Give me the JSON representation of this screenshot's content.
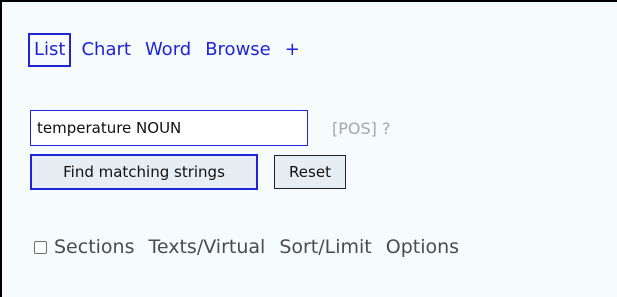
{
  "nav": {
    "items": [
      {
        "label": "List",
        "active": true
      },
      {
        "label": "Chart"
      },
      {
        "label": "Word"
      },
      {
        "label": "Browse"
      },
      {
        "label": "+"
      }
    ]
  },
  "search": {
    "value": "temperature NOUN",
    "pos_hint": "[POS] ?"
  },
  "buttons": {
    "find_label": "Find matching strings",
    "reset_label": "Reset"
  },
  "options": {
    "sections_label": "Sections",
    "sections_checked": false,
    "texts_virtual_label": "Texts/Virtual",
    "sort_limit_label": "Sort/Limit",
    "options_label": "Options"
  },
  "colors": {
    "accent": "#1f24d8",
    "panel_bg": "#f6fbfd",
    "button_bg": "#e7eef3",
    "muted_text": "#a7a7a7"
  }
}
